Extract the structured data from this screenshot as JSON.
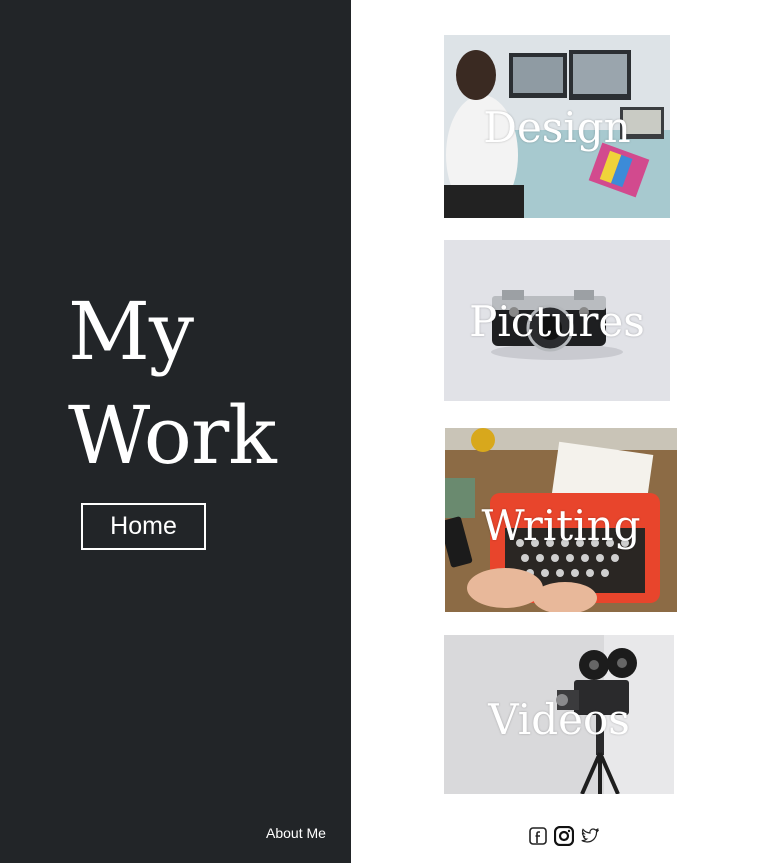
{
  "sidebar": {
    "title_line1": "My",
    "title_line2": "Work",
    "home_label": "Home",
    "about_label": "About Me"
  },
  "tiles": [
    {
      "label": "Design",
      "image": "woman at desk with monitors and color swatches"
    },
    {
      "label": "Pictures",
      "image": "vintage rangefinder camera"
    },
    {
      "label": "Writing",
      "image": "hands typing on red typewriter"
    },
    {
      "label": "Videos",
      "image": "vintage film camera on tripod"
    }
  ],
  "social": {
    "icons": [
      "facebook-icon",
      "instagram-icon",
      "twitter-icon"
    ]
  },
  "colors": {
    "sidebar_bg": "#222528",
    "text_light": "#ffffff",
    "accent_red": "#e8452c"
  }
}
